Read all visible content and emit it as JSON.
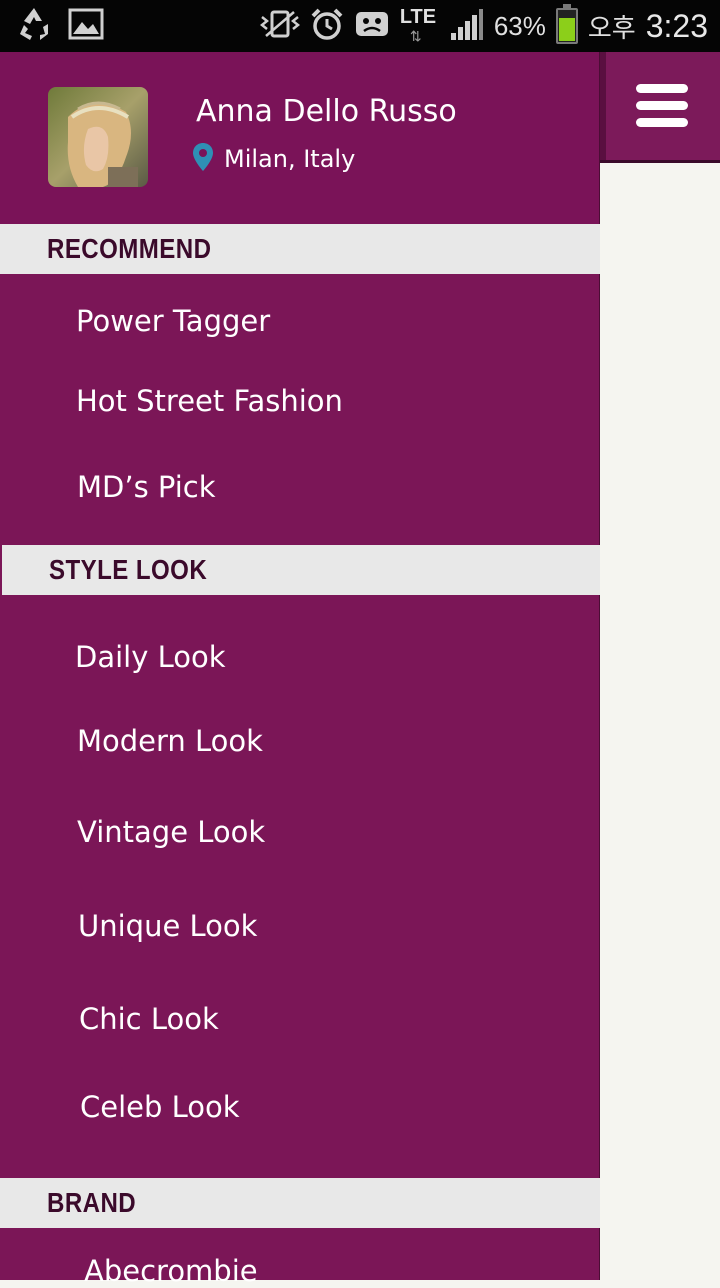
{
  "status_bar": {
    "left_icons": [
      "recycle-icon",
      "image-icon"
    ],
    "right_icons": [
      "vibrate-icon",
      "alarm-icon",
      "notification-icon",
      "lte-icon",
      "signal-icon",
      "battery-icon"
    ],
    "network": "LTE",
    "battery_percent": "63%",
    "carrier_text": "오후",
    "time": "3:23"
  },
  "profile": {
    "name": "Anna Dello Russo",
    "location": "Milan, Italy",
    "location_icon": "map-pin-icon",
    "pin_color": "#2f8fb5"
  },
  "drawer": {
    "sections": [
      {
        "title": "RECOMMEND",
        "items": [
          "Power Tagger",
          "Hot Street Fashion",
          "MD’s Pick"
        ]
      },
      {
        "title": "STYLE LOOK",
        "items": [
          "Daily Look",
          "Modern Look",
          "Vintage Look",
          "Unique Look",
          "Chic Look",
          "Celeb Look"
        ]
      },
      {
        "title": "BRAND",
        "items": [
          "Abecrombie"
        ]
      }
    ]
  },
  "topbar": {
    "menu_icon": "hamburger-icon"
  },
  "colors": {
    "drawer_bg": "#7b1657",
    "section_header_bg": "#e8e8e8",
    "section_header_text": "#3b0a2b",
    "content_bg": "#f5f5f0",
    "battery_fill": "#8ccf1a"
  }
}
